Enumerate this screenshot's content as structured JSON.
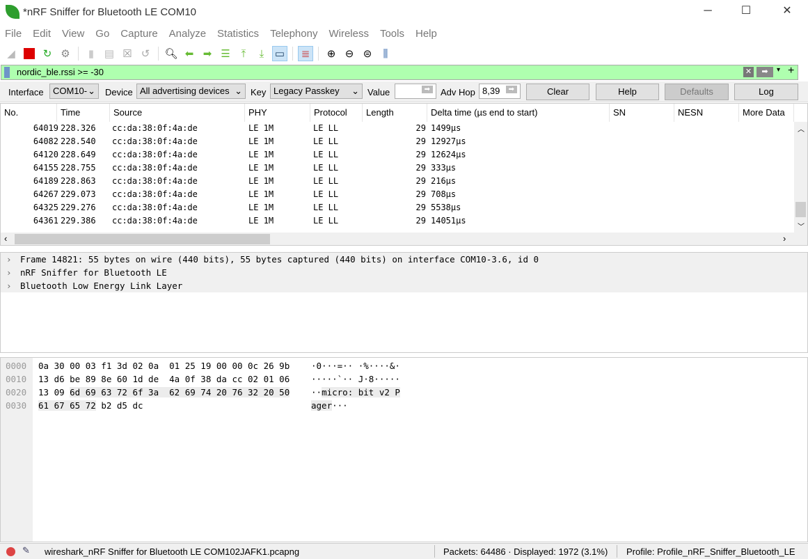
{
  "window": {
    "title": "*nRF Sniffer for Bluetooth LE COM10"
  },
  "menu": [
    "File",
    "Edit",
    "View",
    "Go",
    "Capture",
    "Analyze",
    "Statistics",
    "Telephony",
    "Wireless",
    "Tools",
    "Help"
  ],
  "filter": {
    "value": "nordic_ble.rssi >= -30"
  },
  "controls": {
    "interface_label": "Interface",
    "interface_value": "COM10-",
    "device_label": "Device",
    "device_value": "All advertising devices",
    "key_label": "Key",
    "key_value": "Legacy Passkey",
    "value_label": "Value",
    "value_value": "",
    "advhop_label": "Adv Hop",
    "advhop_value": "8,39",
    "clear": "Clear",
    "help": "Help",
    "defaults": "Defaults",
    "log": "Log"
  },
  "packet_list": {
    "columns": [
      "No.",
      "Time",
      "Source",
      "PHY",
      "Protocol",
      "Length",
      "Delta time (µs end to start)",
      "SN",
      "NESN",
      "More Data"
    ],
    "rows": [
      [
        "64019",
        "228.326",
        "cc:da:38:0f:4a:de",
        "LE 1M",
        "LE LL",
        "29",
        "1499µs"
      ],
      [
        "64082",
        "228.540",
        "cc:da:38:0f:4a:de",
        "LE 1M",
        "LE LL",
        "29",
        "12927µs"
      ],
      [
        "64120",
        "228.649",
        "cc:da:38:0f:4a:de",
        "LE 1M",
        "LE LL",
        "29",
        "12624µs"
      ],
      [
        "64155",
        "228.755",
        "cc:da:38:0f:4a:de",
        "LE 1M",
        "LE LL",
        "29",
        "333µs"
      ],
      [
        "64189",
        "228.863",
        "cc:da:38:0f:4a:de",
        "LE 1M",
        "LE LL",
        "29",
        "216µs"
      ],
      [
        "64267",
        "229.073",
        "cc:da:38:0f:4a:de",
        "LE 1M",
        "LE LL",
        "29",
        "708µs"
      ],
      [
        "64325",
        "229.276",
        "cc:da:38:0f:4a:de",
        "LE 1M",
        "LE LL",
        "29",
        "5538µs"
      ],
      [
        "64361",
        "229.386",
        "cc:da:38:0f:4a:de",
        "LE 1M",
        "LE LL",
        "29",
        "14051µs"
      ]
    ]
  },
  "details": [
    "Frame 14821: 55 bytes on wire (440 bits), 55 bytes captured (440 bits) on interface COM10-3.6, id 0",
    "nRF Sniffer for Bluetooth LE",
    "Bluetooth Low Energy Link Layer"
  ],
  "hex": [
    {
      "offset": "0000",
      "hex": [
        [
          "0a 30 00 03 f1 3d 02 0a  01 25 19 00 00 0c 26 9b",
          false
        ]
      ],
      "ascii": [
        [
          "·0···=·· ·%····&·",
          false
        ]
      ]
    },
    {
      "offset": "0010",
      "hex": [
        [
          "13 d6 be 89 8e 60 1d de  4a 0f 38 da cc 02 01 06",
          false
        ]
      ],
      "ascii": [
        [
          "·····`·· J·8·····",
          false
        ]
      ]
    },
    {
      "offset": "0020",
      "hex": [
        [
          "13 09 ",
          false
        ],
        [
          "6d 69 63 72 6f 3a  62 69 74 20 76 32 20 50",
          true
        ]
      ],
      "ascii": [
        [
          "··",
          false
        ],
        [
          "micro: bit v2 P",
          true
        ]
      ]
    },
    {
      "offset": "0030",
      "hex": [
        [
          "61 67 65 72",
          true
        ],
        [
          " b2 d5 dc",
          false
        ]
      ],
      "ascii": [
        [
          "ager",
          true
        ],
        [
          "···",
          false
        ]
      ]
    }
  ],
  "status": {
    "file": "wireshark_nRF Sniffer for Bluetooth LE COM102JAFK1.pcapng",
    "packets": "Packets: 64486 · Displayed: 1972 (3.1%)",
    "profile": "Profile: Profile_nRF_Sniffer_Bluetooth_LE"
  }
}
